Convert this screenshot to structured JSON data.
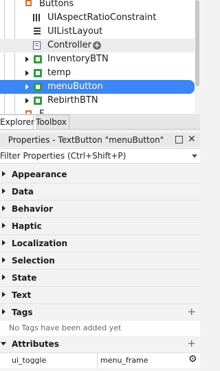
{
  "explorer": {
    "items": [
      {
        "label": "Buttons",
        "icon": "folder-icon"
      },
      {
        "label": "UIAspectRatioConstraint",
        "icon": "aspect-ratio-icon"
      },
      {
        "label": "UIListLayout",
        "icon": "list-layout-icon"
      },
      {
        "label": "Controller",
        "icon": "local-script-icon",
        "extra": "add-icon"
      },
      {
        "label": "InventoryBTN",
        "icon": "text-button-icon"
      },
      {
        "label": "temp",
        "icon": "text-button-icon"
      },
      {
        "label": "menuButton",
        "icon": "text-button-icon"
      },
      {
        "label": "RebirthBTN",
        "icon": "text-button-icon"
      },
      {
        "label": "F",
        "icon": "folder-icon"
      }
    ]
  },
  "tabs": [
    "Explorer",
    "Toolbox"
  ],
  "properties": {
    "title": "Properties - TextButton \"menuButton\"",
    "filter_placeholder": "Filter Properties (Ctrl+Shift+P)",
    "categories": [
      "Appearance",
      "Data",
      "Behavior",
      "Haptic",
      "Localization",
      "Selection",
      "State",
      "Text",
      "Tags",
      "Attributes"
    ],
    "tags_empty": "No Tags have been added yet",
    "attribute": {
      "name": "ui_toggle",
      "value": "menu_frame"
    }
  },
  "colors": {
    "selection": "#3a86f7",
    "text_button_icon": "#2f9e3a",
    "folder_icon": "#e06a2c"
  }
}
